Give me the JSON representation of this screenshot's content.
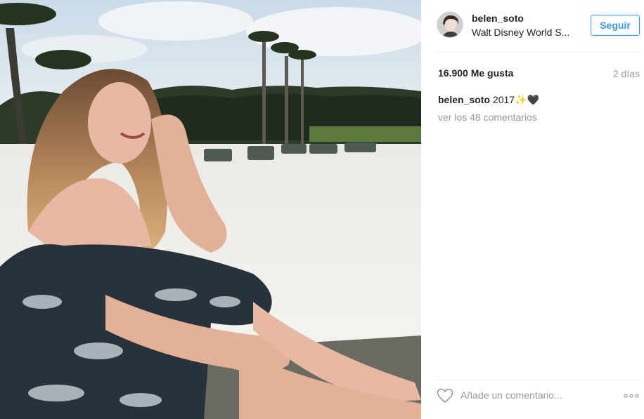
{
  "post": {
    "username": "belen_soto",
    "location": "Walt Disney World S...",
    "follow_label": "Seguir",
    "likes_text": "16.900 Me gusta",
    "time_ago": "2 días",
    "caption": {
      "username": "belen_soto",
      "text": "2017✨🖤"
    },
    "view_comments": "ver los 48 comentarios",
    "comment_placeholder": "Añade un comentario..."
  },
  "icons": {
    "like": "heart-outline-icon",
    "more": "more-options-icon"
  },
  "colors": {
    "accent": "#3897f0",
    "text": "#262626",
    "muted": "#999999",
    "divider": "#efefef"
  }
}
